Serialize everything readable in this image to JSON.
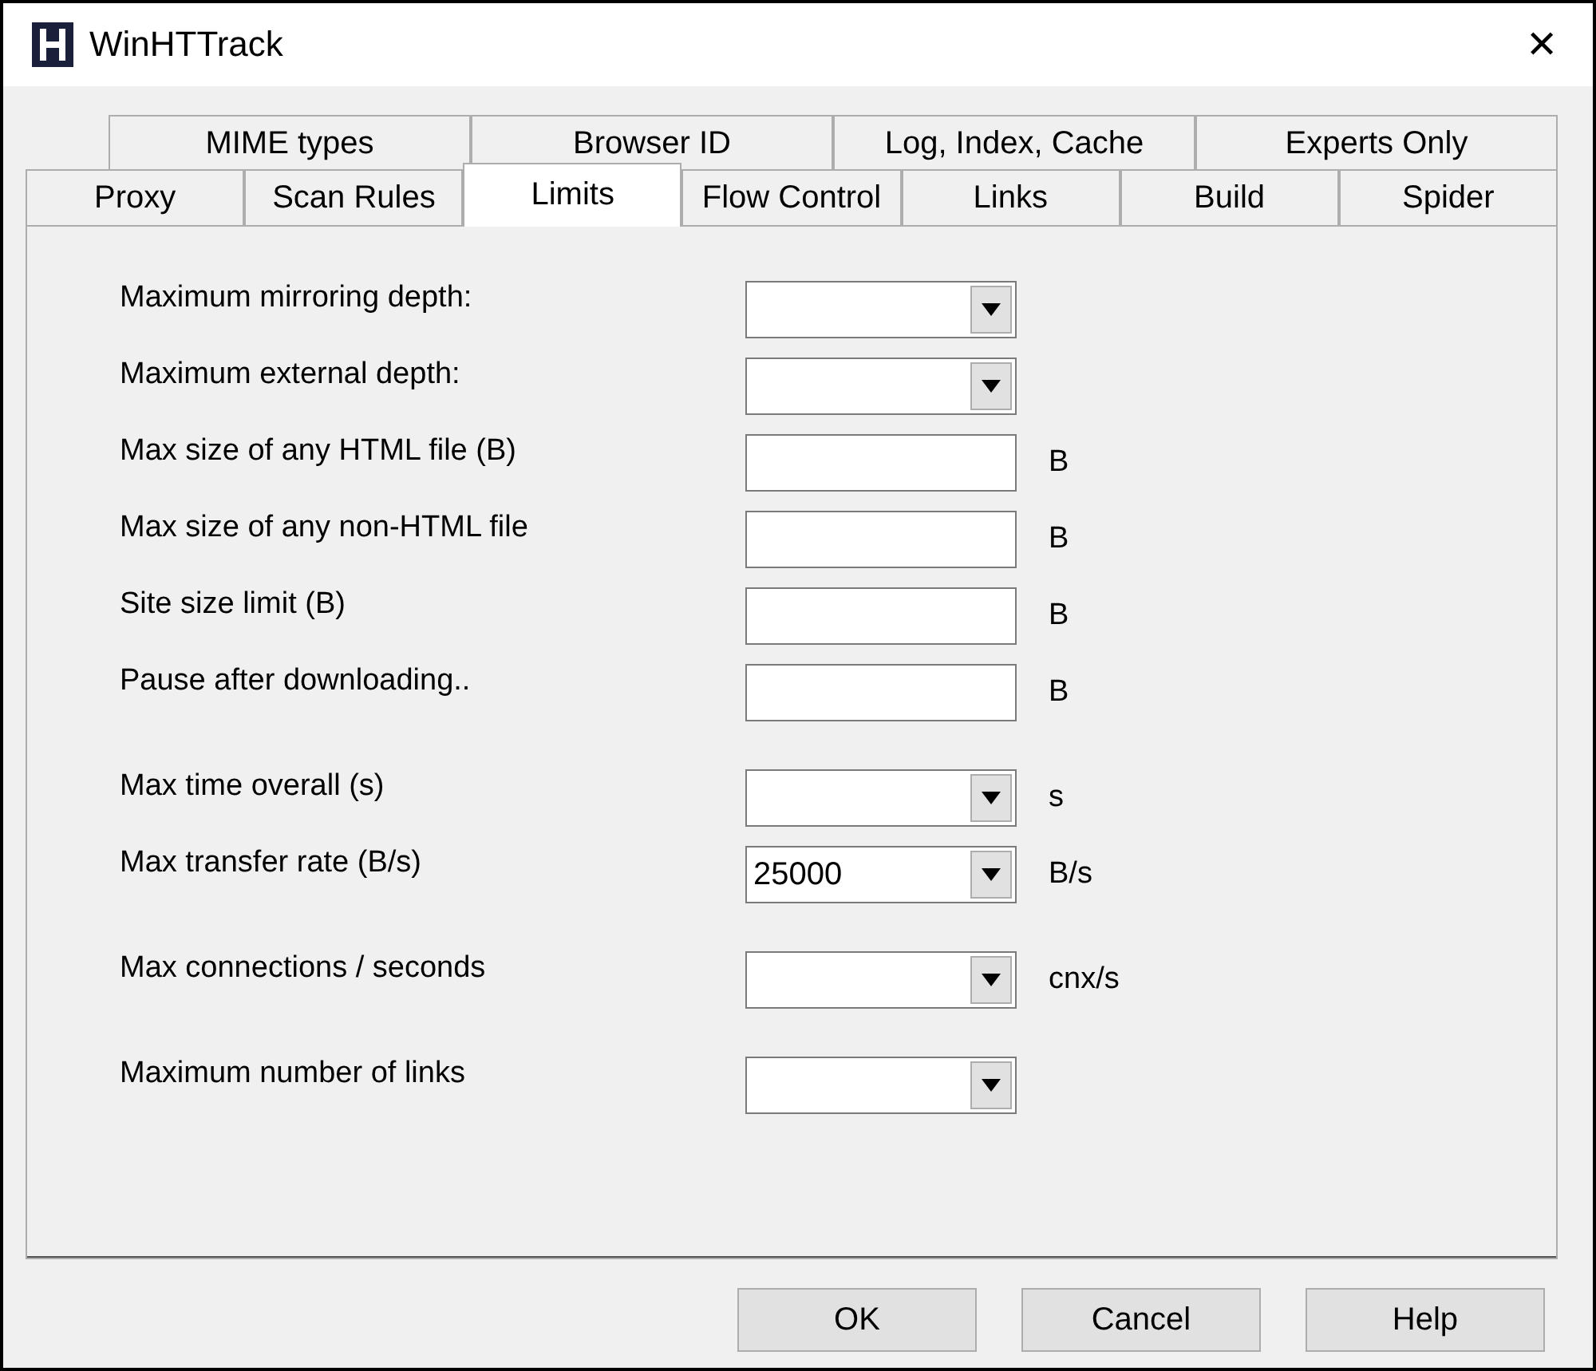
{
  "window": {
    "title": "WinHTTrack",
    "close": "✕"
  },
  "tab_rows": [
    [
      {
        "label": "MIME types",
        "selected": false
      },
      {
        "label": "Browser ID",
        "selected": false
      },
      {
        "label": "Log, Index, Cache",
        "selected": false
      },
      {
        "label": "Experts Only",
        "selected": false
      }
    ],
    [
      {
        "label": "Proxy",
        "selected": false
      },
      {
        "label": "Scan Rules",
        "selected": false
      },
      {
        "label": "Limits",
        "selected": true
      },
      {
        "label": "Flow Control",
        "selected": false
      },
      {
        "label": "Links",
        "selected": false
      },
      {
        "label": "Build",
        "selected": false
      },
      {
        "label": "Spider",
        "selected": false
      }
    ]
  ],
  "groups": [
    [
      {
        "kind": "combo",
        "label": "Maximum mirroring depth:"
      },
      {
        "kind": "combo",
        "label": "Maximum external depth:"
      },
      {
        "kind": "text",
        "label": "Max size of any HTML file (B)",
        "unit": "B"
      },
      {
        "kind": "text",
        "label": "Max size of any non-HTML file",
        "unit": "B"
      },
      {
        "kind": "text",
        "label": "Site size limit (B)",
        "unit": "B"
      },
      {
        "kind": "text",
        "label": "Pause after downloading..",
        "unit": "B"
      }
    ],
    [
      {
        "kind": "combo",
        "label": "Max time overall (s)",
        "unit": "s"
      },
      {
        "kind": "combo",
        "label": "Max transfer rate (B/s)",
        "value": "25000",
        "unit": "B/s"
      }
    ],
    [
      {
        "kind": "combo",
        "label": "Max connections / seconds",
        "unit": "cnx/s"
      }
    ],
    [
      {
        "kind": "combo",
        "label": "Maximum number of links"
      }
    ]
  ],
  "buttons": [
    "OK",
    "Cancel",
    "Help"
  ]
}
